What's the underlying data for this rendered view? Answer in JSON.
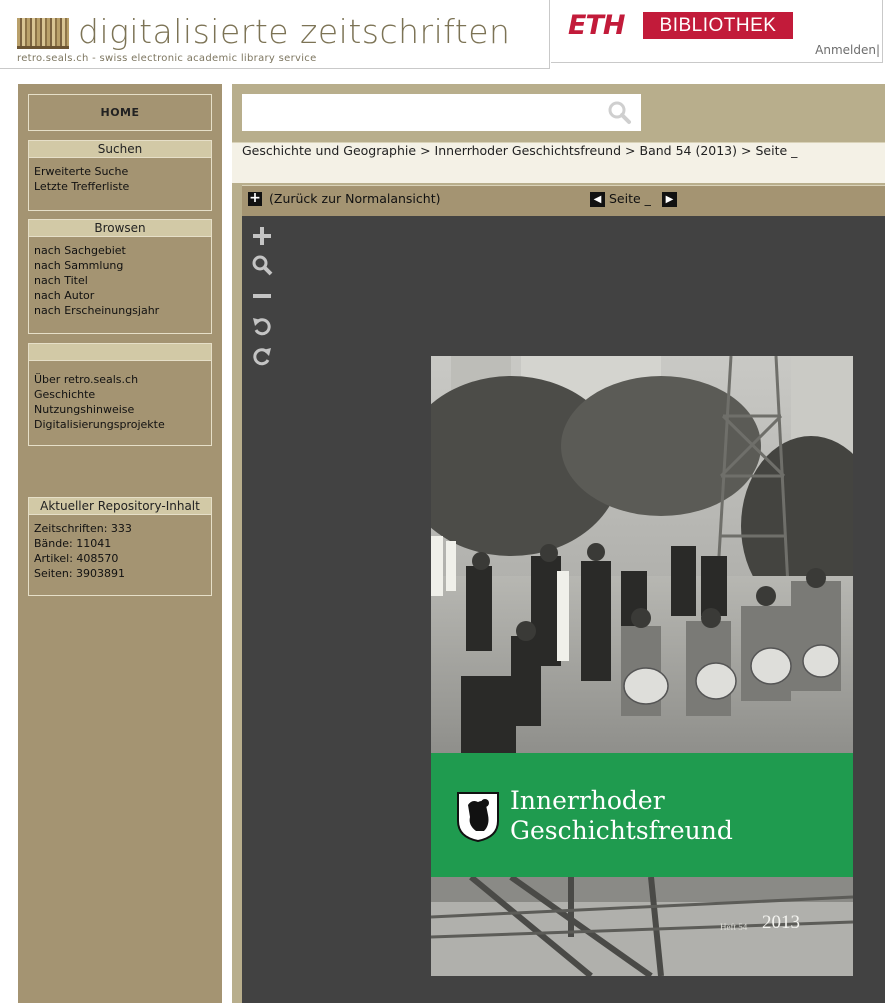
{
  "header": {
    "site_title": "digitalisierte zeitschriften",
    "site_subtitle": "retro.seals.ch - swiss electronic academic library service",
    "eth_logo": "ETH",
    "eth_library": "BIBLIOTHEK",
    "login": "Anmelden|"
  },
  "sidebar": {
    "home": "HOME",
    "search": {
      "heading": "Suchen",
      "items": [
        "Erweiterte Suche",
        "Letzte Trefferliste"
      ]
    },
    "browse": {
      "heading": "Browsen",
      "items": [
        "nach Sachgebiet",
        "nach Sammlung",
        "nach Titel",
        "nach Autor",
        "nach Erscheinungsjahr"
      ]
    },
    "info": {
      "heading": "",
      "items": [
        "Über retro.seals.ch",
        "Geschichte",
        "Nutzungshinweise",
        "Digitalisierungsprojekte"
      ]
    },
    "repository": {
      "heading": "Aktueller Repository-Inhalt",
      "items": [
        "Zeitschriften: 333",
        "Bände: 11041",
        "Artikel: 408570",
        "Seiten: 3903891"
      ]
    }
  },
  "main": {
    "search": {
      "placeholder": "",
      "icon": "magnifier-icon"
    },
    "breadcrumb": [
      "Geschichte und Geographie",
      "Innerrhoder Geschichtsfreund",
      "Band 54 (2013)",
      "Seite _"
    ],
    "breadcrumb_separator": ">",
    "view": {
      "back_label": "(Zurück zur Normalansicht)",
      "page_label": "Seite _"
    },
    "tools": [
      "zoom-in-icon",
      "zoom-fit-icon",
      "zoom-out-icon",
      "rotate-left-icon",
      "rotate-right-icon"
    ],
    "cover": {
      "title_line1": "Innerrhoder",
      "title_line2": "Geschichtsfreund",
      "band": "Heft 54",
      "year": "2013",
      "green": "#1f9b4f"
    }
  },
  "colors": {
    "sidebar": "#a49472",
    "main": "#b8ae8c",
    "viewer": "#424242",
    "eth_red": "#c21b3a"
  }
}
